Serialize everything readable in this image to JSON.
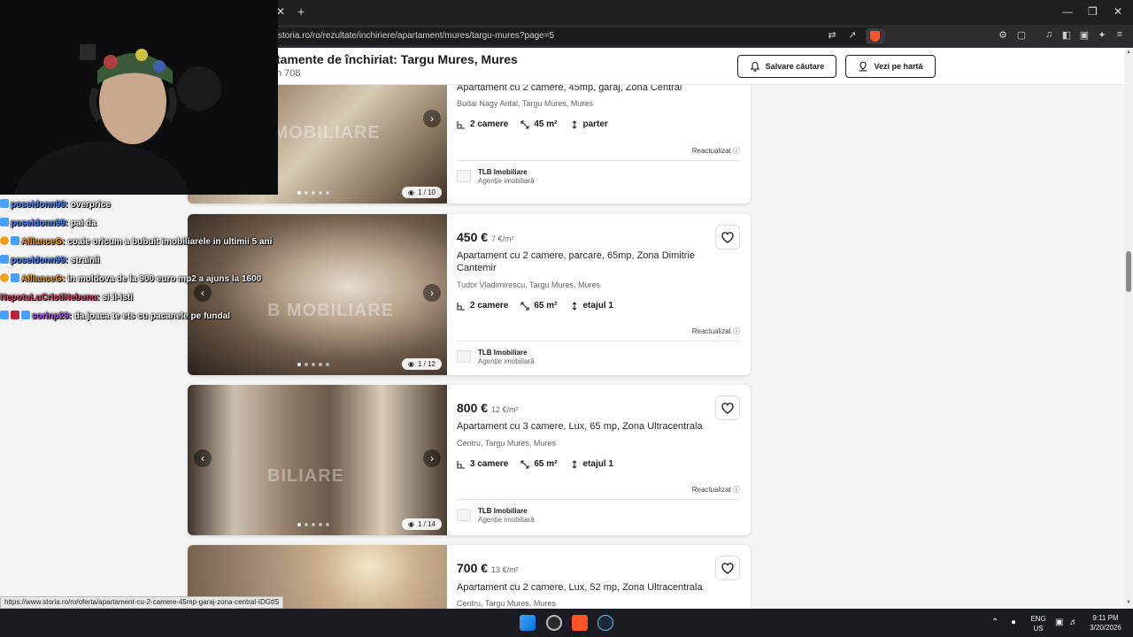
{
  "browser": {
    "url": "storia.ro/ro/rezultate/inchiriere/apartament/mures/targu-mures?page=5",
    "tab_close": "✕",
    "tab_new": "+",
    "status_url": "https://www.storia.ro/ro/oferta/apartament-cu-2-camere-45mp-garaj-zona-central-IDGtlS"
  },
  "header": {
    "title": "tamente de închiriat: Targu Mures, Mures",
    "result_count": "n 708",
    "save_search": "Salvare căutare",
    "view_map": "Vezi pe hartă"
  },
  "listings": [
    {
      "price": "",
      "price_sqm": "",
      "title": "Apartament cu 2 camere, 45mp, garaj, Zona Central",
      "address": "Budai Nagy Antal, Targu Mures, Mures",
      "rooms": "2 camere",
      "area": "45 m²",
      "floor": "parter",
      "updated": "Reactualizat",
      "agency": "TLB Imobiliare",
      "agency_type": "Agenție imobiliară",
      "photo_counter": "1 / 10",
      "watermark": "IMOBILIARE",
      "colors": [
        "#8a7760",
        "#d8cbb3",
        "#5d4a36"
      ]
    },
    {
      "price": "450 €",
      "price_sqm": "7 €/m²",
      "title": "Apartament cu 2 camere, parcare, 65mp, Zona Dimitrie Cantemir",
      "address": "Tudor Vladimirescu, Targu Mures, Mures",
      "rooms": "2 camere",
      "area": "65 m²",
      "floor": "etajul 1",
      "updated": "Reactualizat",
      "agency": "TLB Imobiliare",
      "agency_type": "Agenție imobiliară",
      "photo_counter": "1 / 12",
      "watermark": "B MOBILIARE",
      "colors": [
        "#3a2e27",
        "#c9b9a6",
        "#6e5a49"
      ]
    },
    {
      "price": "800 €",
      "price_sqm": "12 €/m²",
      "title": "Apartament cu 3 camere, Lux, 65 mp, Zona Ultracentrala",
      "address": "Centru, Targu Mures, Mures",
      "rooms": "3 camere",
      "area": "65 m²",
      "floor": "etajul 1",
      "updated": "Reactualizat",
      "agency": "TLB Imobiliare",
      "agency_type": "Agenție imobiliară",
      "photo_counter": "1 / 14",
      "watermark": "BILIARE",
      "colors": [
        "#6b5a4a",
        "#cdbfae",
        "#3f342c"
      ]
    },
    {
      "price": "700 €",
      "price_sqm": "13 €/m²",
      "title": "Apartament cu 2 camere, Lux, 52 mp, Zona Ultracentrala",
      "address": "Centru, Targu Mures, Mures",
      "colors": [
        "#a8907a",
        "#e8d9c4",
        "#7a6552"
      ]
    }
  ],
  "chat": [
    {
      "user": "poseidonn99:",
      "msg": "overprice",
      "color": "#4f8cff"
    },
    {
      "user": "poseidonn99:",
      "msg": "pai da",
      "color": "#4f8cff"
    },
    {
      "user": "AllianceG:",
      "msg": "coaie oricum a bubuit imobiliarele in ultimii 5 ani",
      "color": "#f0a020"
    },
    {
      "user": "poseidonn99:",
      "msg": "strainii",
      "color": "#4f8cff"
    },
    {
      "user": "AllianceG:",
      "msg": "in moldova de la 900 euro mp2 a ajuns la 1600",
      "color": "#f0a020"
    },
    {
      "user": "NepotuLuCristiNebunu:",
      "msg": "si il-isti",
      "color": "#d04060"
    },
    {
      "user": "sorinp29:",
      "msg": "da joaca te ets cu pacanele pe fundal",
      "color": "#b050ff"
    }
  ],
  "taskbar": {
    "lang_top": "ENG",
    "lang_bottom": "US",
    "time": "9:11 PM",
    "date": "3/20/2026"
  }
}
